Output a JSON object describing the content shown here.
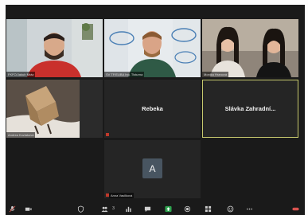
{
  "participants": [
    {
      "name": "Jozef Drumeľov",
      "label_text": "FKFO/Jakub Mráz",
      "kind": "video"
    },
    {
      "name": "SVTF/EUBA Ing.",
      "label_text": "SV TF/EUBA Ing. Tlsturna",
      "kind": "video"
    },
    {
      "name": "Monika Hrnčiar",
      "label_text": "Monika Hranová",
      "kind": "video"
    },
    {
      "name": "Andrea Kvetaňová",
      "label_text": "Andrea Kozlaková",
      "kind": "video"
    },
    {
      "name": "Rebeka",
      "label_text": "",
      "kind": "name"
    },
    {
      "name": "Slávka  Zahradní...",
      "label_text": "",
      "kind": "name"
    },
    {
      "name": "Anna Vasilková",
      "label_text": "Anna Vasilková",
      "kind": "avatar",
      "initial": "A"
    }
  ],
  "toolbar": {
    "participants_count": "3",
    "items": [
      "mic-icon",
      "camera-icon",
      "security-icon",
      "participants-icon",
      "chat-icon",
      "share-icon",
      "record-icon",
      "reactions-icon",
      "apps-icon",
      "more-icon"
    ]
  },
  "colors": {
    "background": "#1a1a1a",
    "tile": "#252525",
    "active_speaker": "#c7c96e",
    "share": "#2ea44f",
    "avatar": "#485561"
  }
}
